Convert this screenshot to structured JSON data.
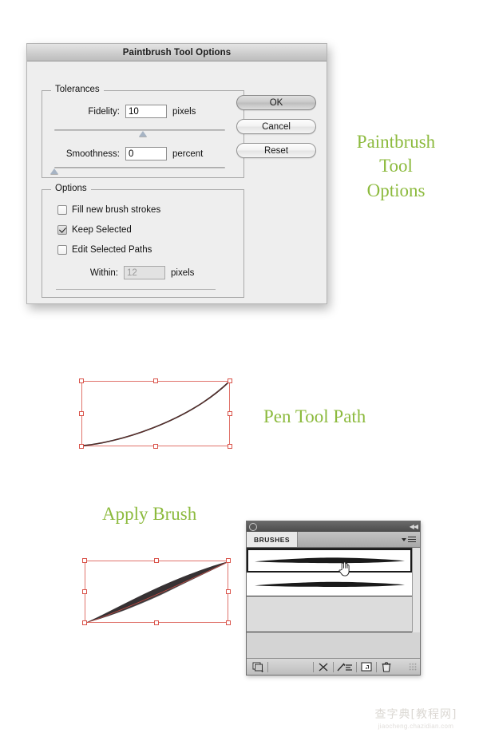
{
  "dialog": {
    "title": "Paintbrush Tool Options",
    "tolerances": {
      "legend": "Tolerances",
      "fidelity_label": "Fidelity:",
      "fidelity_value": "10",
      "fidelity_unit": "pixels",
      "fidelity_slider_percent": 52,
      "smoothness_label": "Smoothness:",
      "smoothness_value": "0",
      "smoothness_unit": "percent",
      "smoothness_slider_percent": 0
    },
    "options": {
      "legend": "Options",
      "fill_new_brush_strokes": {
        "label": "Fill new brush strokes",
        "checked": false
      },
      "keep_selected": {
        "label": "Keep Selected",
        "checked": true
      },
      "edit_selected_paths": {
        "label": "Edit Selected Paths",
        "checked": false
      },
      "within_label": "Within:",
      "within_value": "12",
      "within_unit": "pixels",
      "within_disabled": true
    },
    "buttons": {
      "ok": "OK",
      "cancel": "Cancel",
      "reset": "Reset"
    }
  },
  "annotations": {
    "color": "#8cba3d",
    "paintbrush_tool_options": "Paintbrush\nTool\nOptions",
    "pen_tool_path": "Pen Tool Path",
    "apply_brush": "Apply Brush"
  },
  "artwork": {
    "selection_color": "#d9534a",
    "pen_path": {
      "label": "pen-tool-path-artwork"
    },
    "brushed_path": {
      "label": "brushed-path-artwork"
    }
  },
  "brushes_panel": {
    "tab_label": "BRUSHES",
    "items": [
      {
        "name": "tapered-brush-stroke-1",
        "selected": true
      },
      {
        "name": "tapered-brush-stroke-2",
        "selected": false
      }
    ],
    "footer_icons": [
      "brush-libraries-icon",
      "remove-brush-stroke-icon",
      "brush-options-icon",
      "new-brush-icon",
      "delete-brush-icon"
    ]
  },
  "watermark": {
    "cn": "查字典[教程网]",
    "url": "jiaocheng.chazidian.com"
  }
}
